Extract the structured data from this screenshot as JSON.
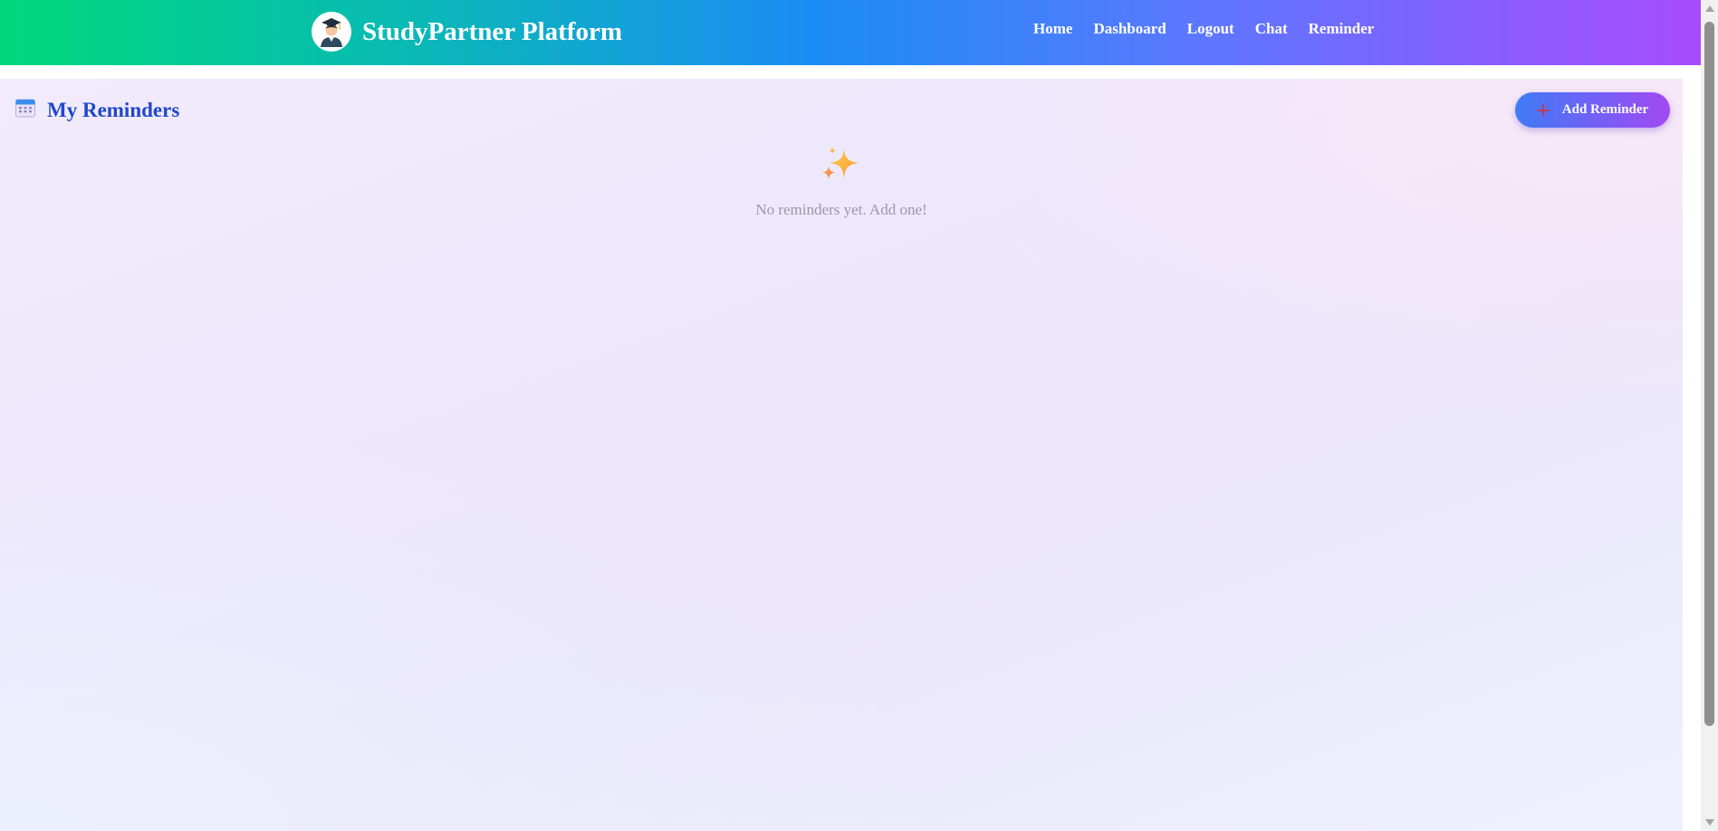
{
  "header": {
    "brand_title": "StudyPartner Platform",
    "logo_icon": "graduate-avatar-icon",
    "nav": [
      {
        "label": "Home"
      },
      {
        "label": "Dashboard"
      },
      {
        "label": "Logout"
      },
      {
        "label": "Chat"
      },
      {
        "label": "Reminder"
      }
    ]
  },
  "reminders": {
    "title": "My Reminders",
    "title_icon": "calendar-icon",
    "add_button_label": "Add Reminder",
    "add_button_icon": "plus-icon",
    "empty_icon": "sparkles-icon",
    "empty_message": "No reminders yet. Add one!"
  },
  "colors": {
    "title": "#2047c9",
    "header_gradient_start": "#00d97a",
    "header_gradient_end": "#a84bff",
    "button_gradient_start": "#3e7bf5",
    "button_gradient_end": "#a349f2",
    "empty_text": "#9a97a8"
  }
}
